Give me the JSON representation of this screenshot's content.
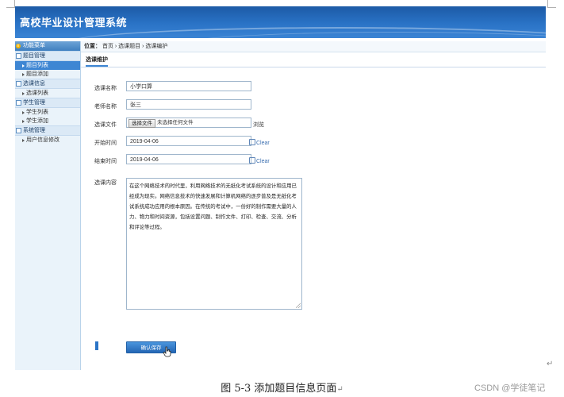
{
  "app": {
    "title": "高校毕业设计管理系统"
  },
  "sidebar": {
    "header": "功能菜单",
    "groups": [
      {
        "title": "题目管理",
        "items": [
          {
            "label": "题目列表",
            "active": true
          },
          {
            "label": "题目添加",
            "active": false
          }
        ]
      },
      {
        "title": "选课信息",
        "items": [
          {
            "label": "选课列表",
            "active": false
          }
        ]
      },
      {
        "title": "学生管理",
        "items": [
          {
            "label": "学生列表",
            "active": false
          },
          {
            "label": "学生添加",
            "active": false
          }
        ]
      },
      {
        "title": "系统管理",
        "items": [
          {
            "label": "用户信息修改",
            "active": false
          }
        ]
      }
    ]
  },
  "breadcrumb": {
    "lead": "位置：",
    "path": "首页 › 选课题目 › 选课编护"
  },
  "tab": {
    "label": "选课维护"
  },
  "form": {
    "course_name": {
      "label": "选课名称",
      "value": "小学口算"
    },
    "teacher_name": {
      "label": "老师名称",
      "value": "张三"
    },
    "file": {
      "label": "选课文件",
      "button": "选择文件",
      "status": "未选择任何文件",
      "browse": "浏览"
    },
    "start_time": {
      "label": "开始时间",
      "value": "2019-04-06",
      "clear": "Clear"
    },
    "end_time": {
      "label": "结束时间",
      "value": "2019-04-06",
      "clear": "Clear"
    },
    "content": {
      "label": "选课内容",
      "value": "在这个网络技术的时代里，利用网络技术的无纸化考试系统的设计和应用已经成为现实。网络信息技术的快速发展和计算机网络的逐步普及是无纸化考试系统成功应用的根本原因。在传统的考试中，一份好的制作需要大量的人力、物力和时间资源，包括设置问题、制作文件、打印、检查、交流、分析和评论等过程。"
    },
    "save_button": "确认保存"
  },
  "caption": "图 5-3 添加题目信息页面",
  "paragraph_mark": "↵",
  "watermark": "CSDN @学徒笔记",
  "colors": {
    "header_blue": "#2a73c6",
    "active_item": "#3e86d3",
    "sidebar_bg": "#eaf3fa"
  }
}
